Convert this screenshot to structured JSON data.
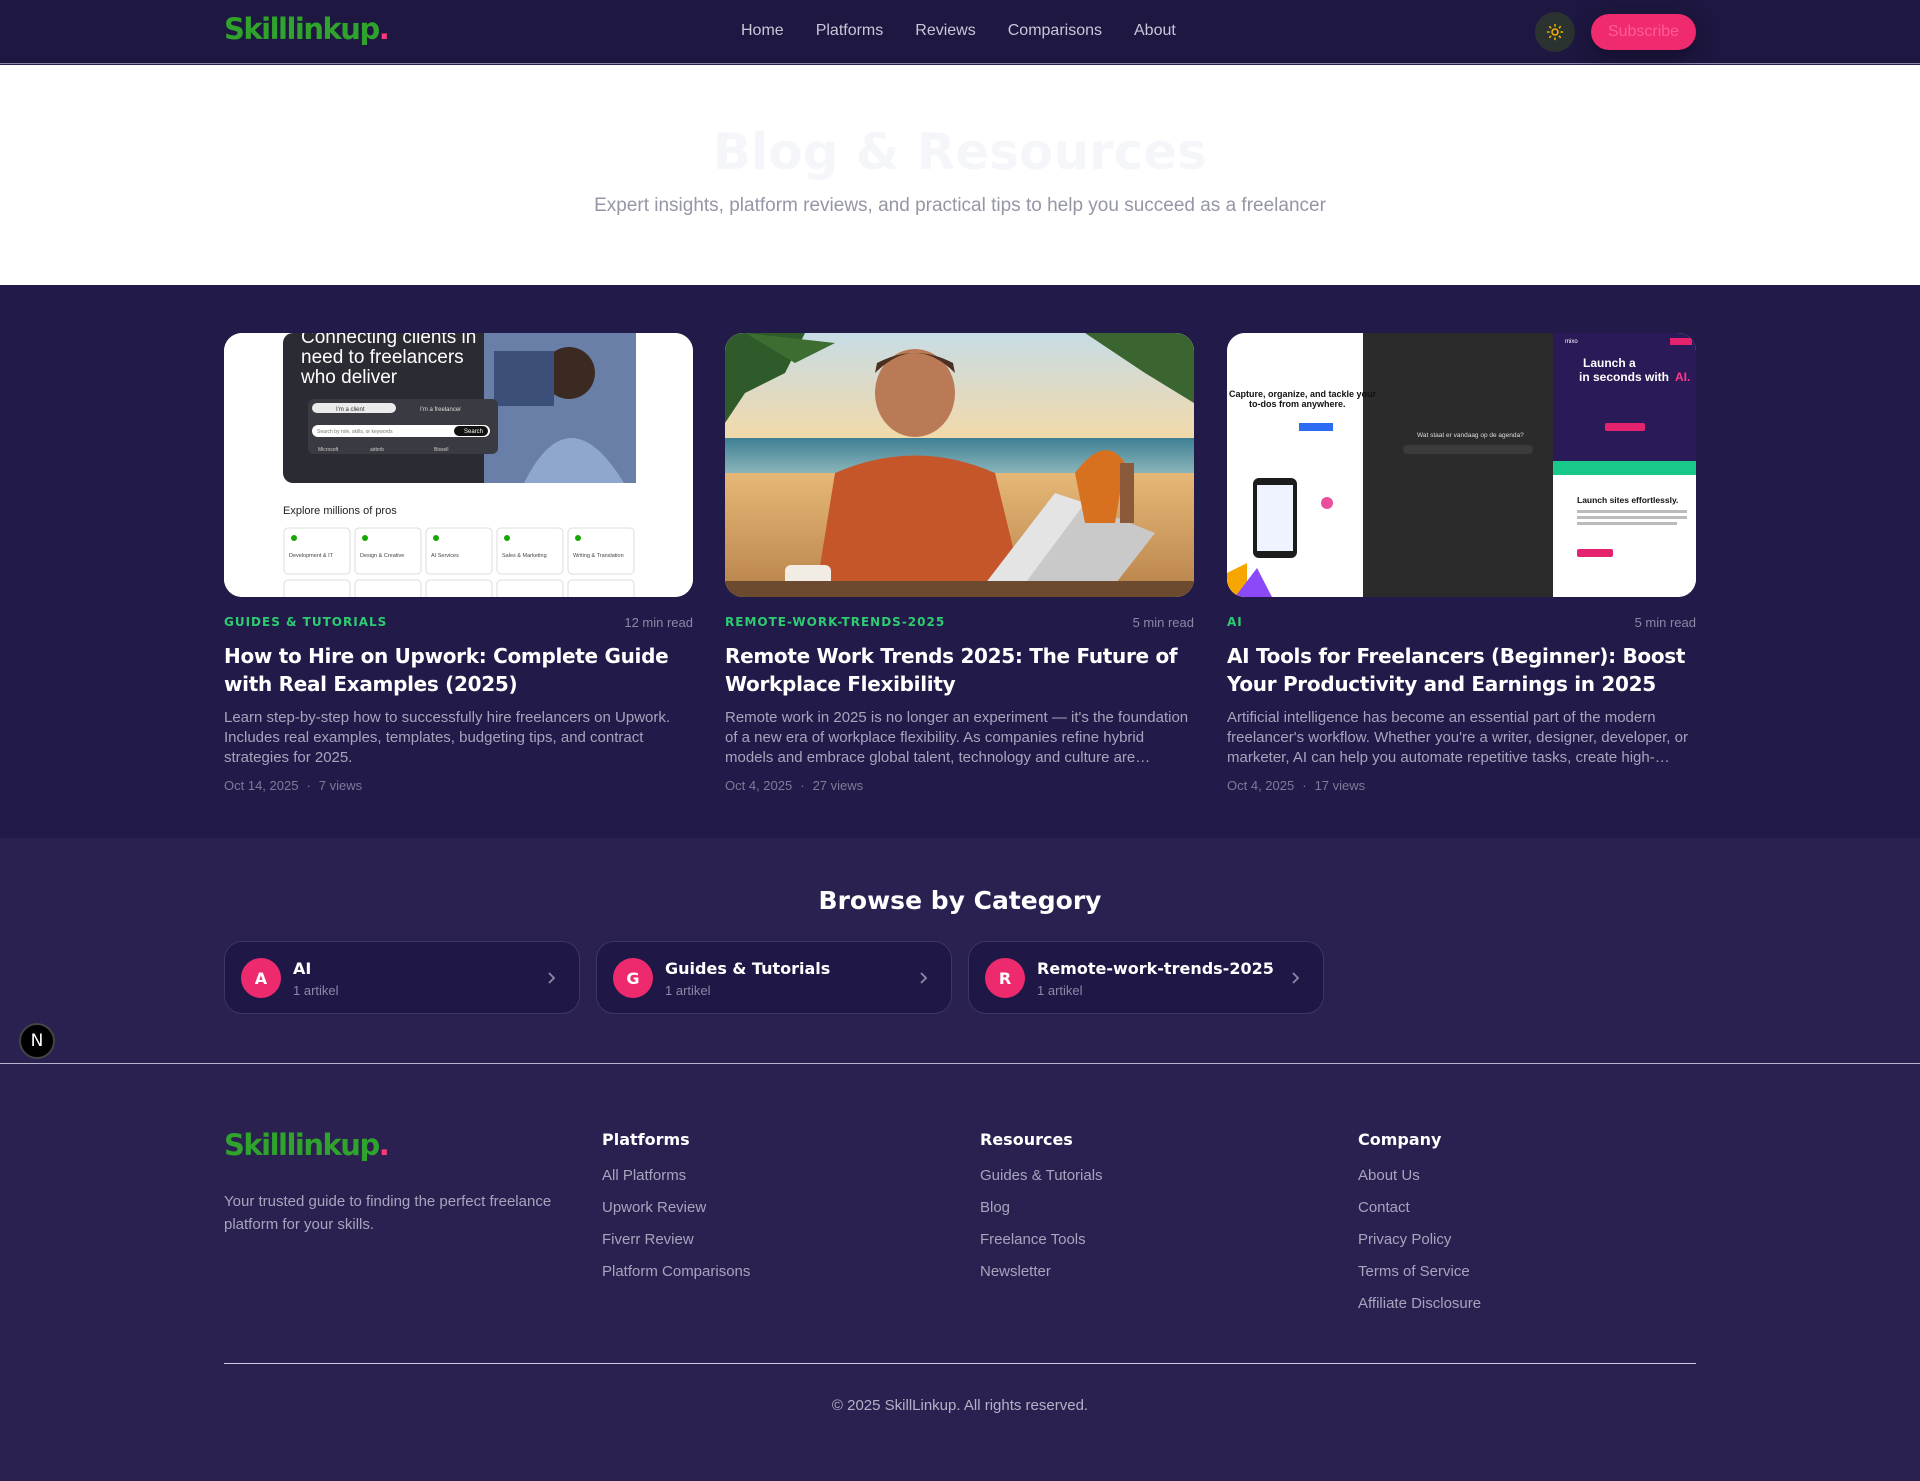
{
  "header": {
    "logo_text": "Skilllinkup",
    "logo_dot": ".",
    "nav": [
      "Home",
      "Platforms",
      "Reviews",
      "Comparisons",
      "About"
    ],
    "subscribe_label": "Subscribe",
    "theme_icon": "sun-icon"
  },
  "hero": {
    "title": "Blog & Resources",
    "subtitle": "Expert insights, platform reviews, and practical tips to help you succeed as a freelancer"
  },
  "articles": [
    {
      "category": "GUIDES & TUTORIALS",
      "read_time": "12 min read",
      "title": "How to Hire on Upwork: Complete Guide with Real Examples (2025)",
      "excerpt": "Learn step-by-step how to successfully hire freelancers on Upwork. Includes real examples, templates, budgeting tips, and contract strategies for 2025.",
      "date": "Oct 14, 2025",
      "views": "7 views",
      "thumb": {
        "headline": "Connecting clients in need to freelancers who deliver",
        "tab1": "I'm a client",
        "tab2": "I'm a freelancer",
        "search_placeholder": "Search by role, skills, or keywords",
        "search_button": "Search",
        "logos": [
          "Microsoft",
          "airbnb",
          "Bissell"
        ],
        "explore": "Explore millions of pros",
        "tiles": [
          "Development & IT",
          "Design & Creative",
          "AI Services",
          "Sales & Marketing",
          "Writing & Translation"
        ]
      }
    },
    {
      "category": "REMOTE-WORK-TRENDS-2025",
      "read_time": "5 min read",
      "title": "Remote Work Trends 2025: The Future of Workplace Flexibility",
      "excerpt": "Remote work in 2025 is no longer an experiment — it's the foundation of a new era of workplace flexibility. As companies refine hybrid models and embrace global talent, technology and culture are…",
      "date": "Oct 4, 2025",
      "views": "27 views"
    },
    {
      "category": "AI",
      "read_time": "5 min read",
      "title": "AI Tools for Freelancers (Beginner): Boost Your Productivity and Earnings in 2025",
      "excerpt": "Artificial intelligence has become an essential part of the modern freelancer's workflow. Whether you're a writer, designer, developer, or marketer, AI can help you automate repetitive tasks, create high-…",
      "date": "Oct 4, 2025",
      "views": "17 views",
      "thumb": {
        "left_heading": "Capture, organize, and tackle your to-dos from anywhere.",
        "mid_text": "Wat staat er vandaag op de agenda?",
        "right_heading_1": "Launch a",
        "right_heading_2": "in seconds with",
        "right_ai": "AI.",
        "right_brand": "mixo",
        "right_sub": "Launch sites effortlessly."
      }
    }
  ],
  "browse": {
    "title": "Browse by Category",
    "categories": [
      {
        "initial": "A",
        "name": "AI",
        "count": "1 artikel"
      },
      {
        "initial": "G",
        "name": "Guides & Tutorials",
        "count": "1 artikel"
      },
      {
        "initial": "R",
        "name": "Remote-work-trends-2025",
        "count": "1 artikel"
      }
    ]
  },
  "fab_label": "N",
  "footer": {
    "tagline": "Your trusted guide to finding the perfect freelance platform for your skills.",
    "columns": [
      {
        "title": "Platforms",
        "links": [
          "All Platforms",
          "Upwork Review",
          "Fiverr Review",
          "Platform Comparisons"
        ]
      },
      {
        "title": "Resources",
        "links": [
          "Guides & Tutorials",
          "Blog",
          "Freelance Tools",
          "Newsletter"
        ]
      },
      {
        "title": "Company",
        "links": [
          "About Us",
          "Contact",
          "Privacy Policy",
          "Terms of Service",
          "Affiliate Disclosure"
        ]
      }
    ],
    "copyright": "© 2025 SkillLinkup. All rights reserved."
  },
  "colors": {
    "accent_pink": "#f02a6e",
    "brand_green": "#2fa32c",
    "category_green": "#2ecc71",
    "header_bg": "#1d1741",
    "page_bg": "#2a2150"
  }
}
